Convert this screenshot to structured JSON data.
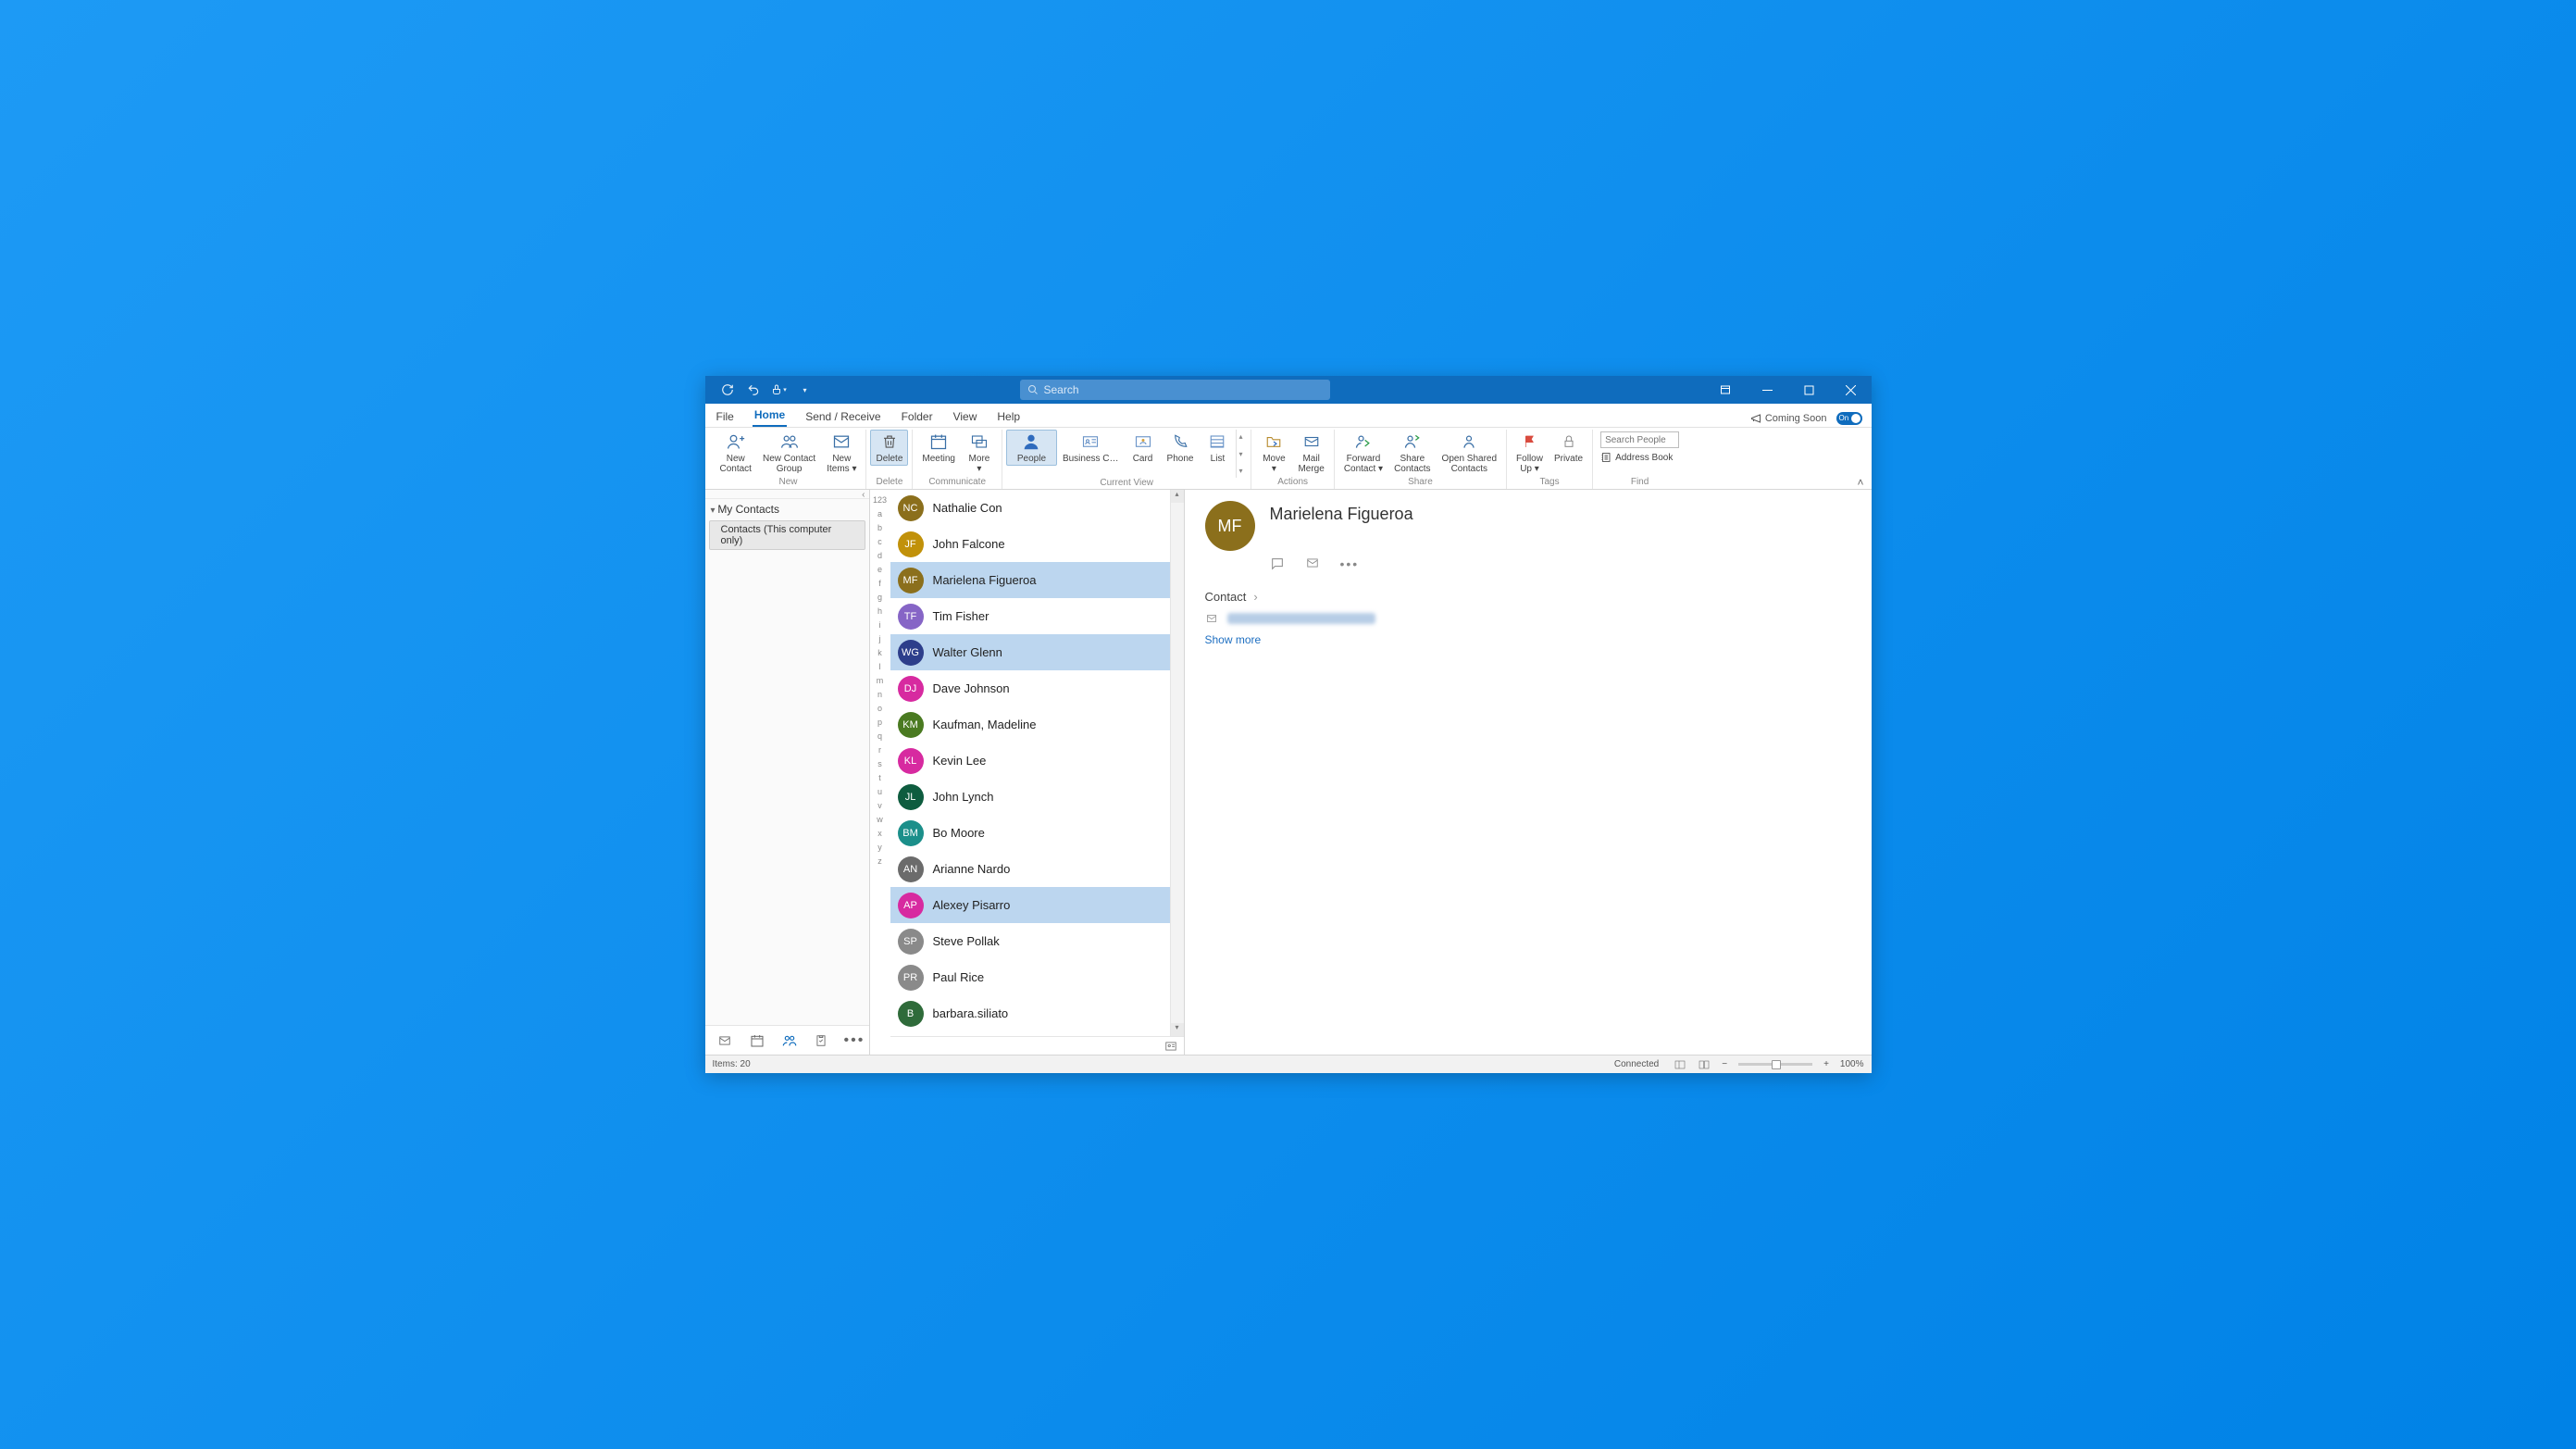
{
  "titlebar": {
    "search_placeholder": "Search"
  },
  "tabs": {
    "file": "File",
    "home": "Home",
    "send_receive": "Send / Receive",
    "folder": "Folder",
    "view": "View",
    "help": "Help",
    "coming_soon": "Coming Soon",
    "toggle": "On"
  },
  "ribbon": {
    "new_contact": "New\nContact",
    "new_contact_group": "New Contact\nGroup",
    "new_items": "New\nItems ▾",
    "group_new": "New",
    "delete": "Delete",
    "group_delete": "Delete",
    "meeting": "Meeting",
    "more": "More\n▾",
    "group_communicate": "Communicate",
    "people": "People",
    "business_c": "Business C…",
    "card": "Card",
    "phone": "Phone",
    "list": "List",
    "group_current_view": "Current View",
    "move": "Move\n▾",
    "mail_merge": "Mail\nMerge",
    "group_actions": "Actions",
    "forward_contact": "Forward\nContact ▾",
    "share_contacts": "Share\nContacts",
    "open_shared": "Open Shared\nContacts",
    "group_share": "Share",
    "follow_up": "Follow\nUp ▾",
    "private": "Private",
    "group_tags": "Tags",
    "search_people_placeholder": "Search People",
    "address_book": "Address Book",
    "group_find": "Find"
  },
  "nav": {
    "my_contacts": "My Contacts",
    "folder1": "Contacts (This computer only)"
  },
  "az_index": [
    "123",
    "a",
    "b",
    "c",
    "d",
    "e",
    "f",
    "g",
    "h",
    "i",
    "j",
    "k",
    "l",
    "m",
    "n",
    "o",
    "p",
    "q",
    "r",
    "s",
    "t",
    "u",
    "v",
    "w",
    "x",
    "y",
    "z"
  ],
  "contacts": [
    {
      "initials": "NC",
      "name": "Nathalie Con",
      "color": "#8b6f1c",
      "selected": false
    },
    {
      "initials": "JF",
      "name": "John Falcone",
      "color": "#c1910a",
      "selected": false
    },
    {
      "initials": "MF",
      "name": "Marielena Figueroa",
      "color": "#8b6f1c",
      "selected": true
    },
    {
      "initials": "TF",
      "name": "Tim Fisher",
      "color": "#8665c6",
      "selected": false
    },
    {
      "initials": "WG",
      "name": "Walter Glenn",
      "color": "#2d3e8b",
      "selected": true
    },
    {
      "initials": "DJ",
      "name": "Dave Johnson",
      "color": "#d72aa0",
      "selected": false
    },
    {
      "initials": "KM",
      "name": "Kaufman, Madeline",
      "color": "#4a7a21",
      "selected": false
    },
    {
      "initials": "KL",
      "name": "Kevin Lee",
      "color": "#d72aa0",
      "selected": false
    },
    {
      "initials": "JL",
      "name": "John Lynch",
      "color": "#0e5c3f",
      "selected": false
    },
    {
      "initials": "BM",
      "name": "Bo Moore",
      "color": "#1b8f8a",
      "selected": false
    },
    {
      "initials": "AN",
      "name": "Arianne Nardo",
      "color": "#6b6b6b",
      "selected": false
    },
    {
      "initials": "AP",
      "name": "Alexey Pisarro",
      "color": "#d72aa0",
      "selected": true
    },
    {
      "initials": "SP",
      "name": "Steve Pollak",
      "color": "#8a8a8a",
      "selected": false
    },
    {
      "initials": "PR",
      "name": "Paul Rice",
      "color": "#8a8a8a",
      "selected": false
    },
    {
      "initials": "B",
      "name": "barbara.siliato",
      "color": "#2f6b3a",
      "selected": false
    }
  ],
  "reading": {
    "initials": "MF",
    "name": "Marielena Figueroa",
    "section_contact": "Contact",
    "show_more": "Show more"
  },
  "status": {
    "items": "Items: 20",
    "connected": "Connected",
    "zoom": "100%"
  }
}
